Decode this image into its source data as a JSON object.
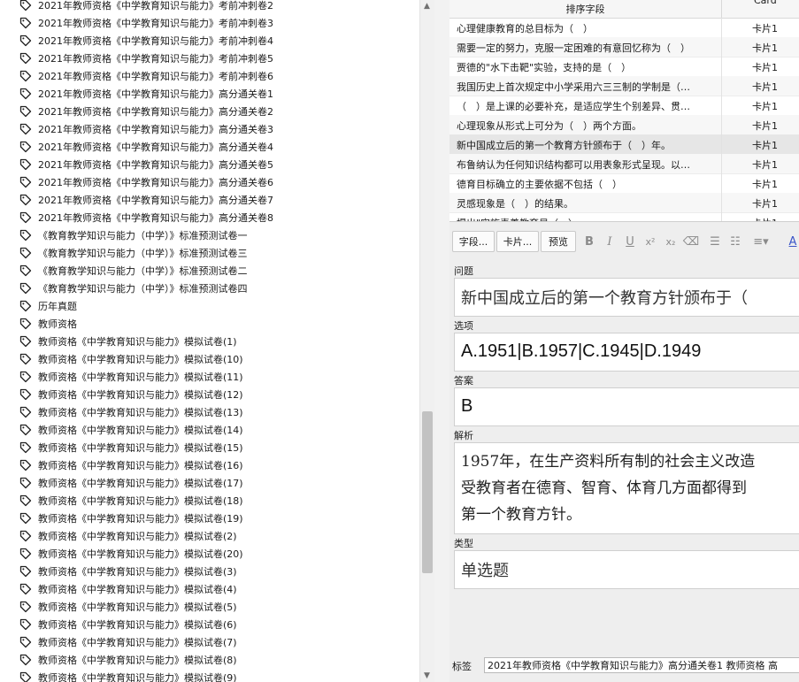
{
  "tags": [
    "2021年教师资格《中学教育知识与能力》考前冲刺卷2",
    "2021年教师资格《中学教育知识与能力》考前冲刺卷3",
    "2021年教师资格《中学教育知识与能力》考前冲刺卷4",
    "2021年教师资格《中学教育知识与能力》考前冲刺卷5",
    "2021年教师资格《中学教育知识与能力》考前冲刺卷6",
    "2021年教师资格《中学教育知识与能力》高分通关卷1",
    "2021年教师资格《中学教育知识与能力》高分通关卷2",
    "2021年教师资格《中学教育知识与能力》高分通关卷3",
    "2021年教师资格《中学教育知识与能力》高分通关卷4",
    "2021年教师资格《中学教育知识与能力》高分通关卷5",
    "2021年教师资格《中学教育知识与能力》高分通关卷6",
    "2021年教师资格《中学教育知识与能力》高分通关卷7",
    "2021年教师资格《中学教育知识与能力》高分通关卷8",
    "《教育教学知识与能力（中学）》标准预测试卷一",
    "《教育教学知识与能力（中学）》标准预测试卷三",
    "《教育教学知识与能力（中学）》标准预测试卷二",
    "《教育教学知识与能力（中学）》标准预测试卷四",
    "历年真题",
    "教师资格",
    "教师资格《中学教育知识与能力》模拟试卷(1)",
    "教师资格《中学教育知识与能力》模拟试卷(10)",
    "教师资格《中学教育知识与能力》模拟试卷(11)",
    "教师资格《中学教育知识与能力》模拟试卷(12)",
    "教师资格《中学教育知识与能力》模拟试卷(13)",
    "教师资格《中学教育知识与能力》模拟试卷(14)",
    "教师资格《中学教育知识与能力》模拟试卷(15)",
    "教师资格《中学教育知识与能力》模拟试卷(16)",
    "教师资格《中学教育知识与能力》模拟试卷(17)",
    "教师资格《中学教育知识与能力》模拟试卷(18)",
    "教师资格《中学教育知识与能力》模拟试卷(19)",
    "教师资格《中学教育知识与能力》模拟试卷(2)",
    "教师资格《中学教育知识与能力》模拟试卷(20)",
    "教师资格《中学教育知识与能力》模拟试卷(3)",
    "教师资格《中学教育知识与能力》模拟试卷(4)",
    "教师资格《中学教育知识与能力》模拟试卷(5)",
    "教师资格《中学教育知识与能力》模拟试卷(6)",
    "教师资格《中学教育知识与能力》模拟试卷(7)",
    "教师资格《中学教育知识与能力》模拟试卷(8)",
    "教师资格《中学教育知识与能力》模拟试卷(9)"
  ],
  "table": {
    "col_sort": "排序字段",
    "col_card": "Card",
    "rows": [
      {
        "sort": "心理健康教育的总目标为（　）",
        "card": "卡片1"
      },
      {
        "sort": "需要一定的努力，克服一定困难的有意回忆称为（　）",
        "card": "卡片1"
      },
      {
        "sort": "贾德的\"水下击靶\"实验，支持的是（　）",
        "card": "卡片1"
      },
      {
        "sort": "我国历史上首次规定中小学采用六三三制的学制是（…",
        "card": "卡片1"
      },
      {
        "sort": "（　）是上课的必要补充，是适应学生个别差异、贯…",
        "card": "卡片1"
      },
      {
        "sort": "心理现象从形式上可分为（　）两个方面。",
        "card": "卡片1"
      },
      {
        "sort": "新中国成立后的第一个教育方针颁布于（　）年。",
        "card": "卡片1"
      },
      {
        "sort": "布鲁纳认为任何知识结构都可以用表象形式呈现。以…",
        "card": "卡片1"
      },
      {
        "sort": "德育目标确立的主要依据不包括（　）",
        "card": "卡片1"
      },
      {
        "sort": "灵感现象是（　）的结果。",
        "card": "卡片1"
      },
      {
        "sort": "提出\"实施素养教育是（　）",
        "card": "卡片1"
      }
    ]
  },
  "toolbar": {
    "fields_btn": "字段...",
    "cards_btn": "卡片...",
    "preview_btn": "预览"
  },
  "editor": {
    "question_label": "问题",
    "question_value": "新中国成立后的第一个教育方针颁布于（",
    "options_label": "选项",
    "options_value": "A.1951|B.1957|C.1945|D.1949",
    "answer_label": "答案",
    "answer_value": "B",
    "analysis_label": "解析",
    "analysis_line1": "1957年，在生产资料所有制的社会主义改造",
    "analysis_line2": "受教育者在德育、智育、体育几方面都得到",
    "analysis_line3": "第一个教育方针。",
    "type_label": "类型",
    "type_value": "单选题",
    "tags_label": "标签",
    "tags_value": "2021年教师资格《中学教育知识与能力》高分通关卷1 教师资格 高"
  }
}
